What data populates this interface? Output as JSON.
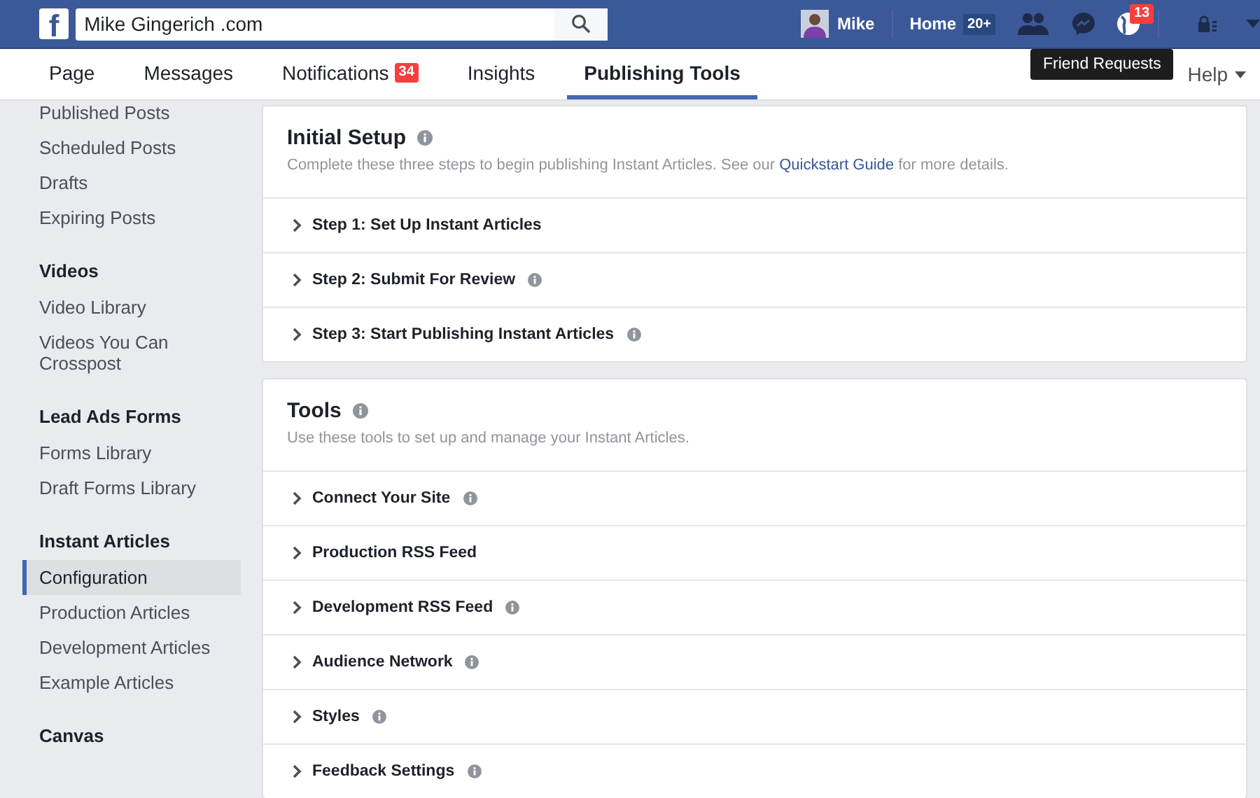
{
  "topbar": {
    "logo": "f",
    "search": {
      "value": "Mike Gingerich .com"
    },
    "profile": {
      "name": "Mike"
    },
    "home": {
      "label": "Home",
      "badge": "20+"
    },
    "notifications_badge": "13",
    "tooltip": "Friend Requests"
  },
  "tabs": [
    {
      "label": "Page",
      "selected": false
    },
    {
      "label": "Messages",
      "selected": false
    },
    {
      "label": "Notifications",
      "selected": false,
      "badge": "34"
    },
    {
      "label": "Insights",
      "selected": false
    },
    {
      "label": "Publishing Tools",
      "selected": true
    }
  ],
  "help": {
    "label": "Help"
  },
  "sidebar": {
    "sections": [
      {
        "items": [
          {
            "label": "Published Posts",
            "selected": false
          },
          {
            "label": "Scheduled Posts",
            "selected": false
          },
          {
            "label": "Drafts",
            "selected": false
          },
          {
            "label": "Expiring Posts",
            "selected": false
          }
        ]
      },
      {
        "heading": "Videos",
        "items": [
          {
            "label": "Video Library",
            "selected": false
          },
          {
            "label": "Videos You Can Crosspost",
            "selected": false
          }
        ]
      },
      {
        "heading": "Lead Ads Forms",
        "items": [
          {
            "label": "Forms Library",
            "selected": false
          },
          {
            "label": "Draft Forms Library",
            "selected": false
          }
        ]
      },
      {
        "heading": "Instant Articles",
        "items": [
          {
            "label": "Configuration",
            "selected": true
          },
          {
            "label": "Production Articles",
            "selected": false
          },
          {
            "label": "Development Articles",
            "selected": false
          },
          {
            "label": "Example Articles",
            "selected": false
          }
        ]
      },
      {
        "heading": "Canvas"
      }
    ]
  },
  "cards": [
    {
      "title": "Initial Setup",
      "info": true,
      "description": {
        "text": "Complete these three steps to begin publishing Instant Articles. See our ",
        "link": "Quickstart Guide",
        "after": " for more details."
      },
      "rows": [
        {
          "label": "Step 1: Set Up Instant Articles",
          "info": false
        },
        {
          "label": "Step 2: Submit For Review",
          "info": true
        },
        {
          "label": "Step 3: Start Publishing Instant Articles",
          "info": true
        }
      ]
    },
    {
      "title": "Tools",
      "info": true,
      "description": {
        "text": "Use these tools to set up and manage your Instant Articles."
      },
      "rows": [
        {
          "label": "Connect Your Site",
          "info": true
        },
        {
          "label": "Production RSS Feed",
          "info": false
        },
        {
          "label": "Development RSS Feed",
          "info": true
        },
        {
          "label": "Audience Network",
          "info": true
        },
        {
          "label": "Styles",
          "info": true
        },
        {
          "label": "Feedback Settings",
          "info": true
        }
      ]
    }
  ]
}
